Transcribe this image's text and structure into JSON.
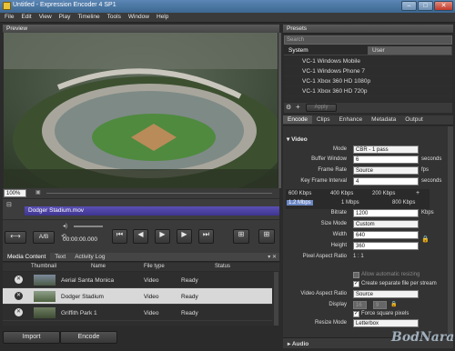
{
  "window": {
    "title": "Untitled - Expression Encoder 4 SP1",
    "min": "–",
    "max": "□",
    "close": "✕"
  },
  "menu": [
    "File",
    "Edit",
    "View",
    "Play",
    "Timeline",
    "Tools",
    "Window",
    "Help"
  ],
  "preview": {
    "header": "Preview",
    "zoom": "100%",
    "clip_name": "Dodger Stadium.mov",
    "ab_label": "A/B",
    "timecode": "00:00:00.000"
  },
  "media_tabs": [
    "Media Content",
    "Text",
    "Activity Log"
  ],
  "media_columns": [
    "Thumbnail",
    "Name",
    "File type",
    "Status"
  ],
  "media_items": [
    {
      "name": "Aerial Santa Monica",
      "type": "Video",
      "status": "Ready"
    },
    {
      "name": "Dodger Stadium",
      "type": "Video",
      "status": "Ready"
    },
    {
      "name": "Griffith Park 1",
      "type": "Video",
      "status": "Ready"
    }
  ],
  "bottom_buttons": {
    "import": "Import",
    "encode": "Encode"
  },
  "presets": {
    "header": "Presets",
    "search_placeholder": "Search",
    "tabs": [
      "System",
      "User"
    ],
    "items": [
      "VC-1 Windows Mobile",
      "VC-1 Windows Phone 7",
      "VC-1 Xbox 360 HD 1080p",
      "VC-1 Xbox 360 HD 720p"
    ],
    "apply": "Apply"
  },
  "encode_tabs": [
    "Encode",
    "Clips",
    "Enhance",
    "Metadata",
    "Output"
  ],
  "encode": {
    "section": "Video",
    "mode_label": "Mode",
    "mode_value": "CBR - 1 pass",
    "buffer_label": "Buffer Window",
    "buffer_value": "6",
    "buffer_unit": "seconds",
    "framerate_label": "Frame Rate",
    "framerate_value": "Source",
    "framerate_unit": "fps",
    "keyframe_label": "Key Frame Interval",
    "keyframe_value": "4",
    "keyframe_unit": "seconds",
    "streams": [
      "600 Kbps",
      "400 Kbps",
      "200 Kbps",
      "+"
    ],
    "streams2": [
      "1.2 Mbps",
      "1 Mbps",
      "800 Kbps"
    ],
    "bitrate_label": "Bitrate",
    "bitrate_value": "1200",
    "bitrate_unit": "Kbps",
    "sizemode_label": "Size Mode",
    "sizemode_value": "Custom",
    "width_label": "Width",
    "width_value": "640",
    "height_label": "Height",
    "height_value": "360",
    "par_label": "Pixel Aspect Ratio",
    "par_value": "1 : 1",
    "allow_resize": "Allow automatic resizing",
    "separate_file": "Create separate file per stream",
    "var_label": "Video Aspect Ratio",
    "var_value": "Source",
    "display_label": "Display",
    "display_w": "16",
    "display_h": "9",
    "force_square": "Force square pixels",
    "resize_label": "Resize Mode",
    "resize_value": "Letterbox",
    "audio_section": "Audio"
  },
  "watermark": "BodNara"
}
